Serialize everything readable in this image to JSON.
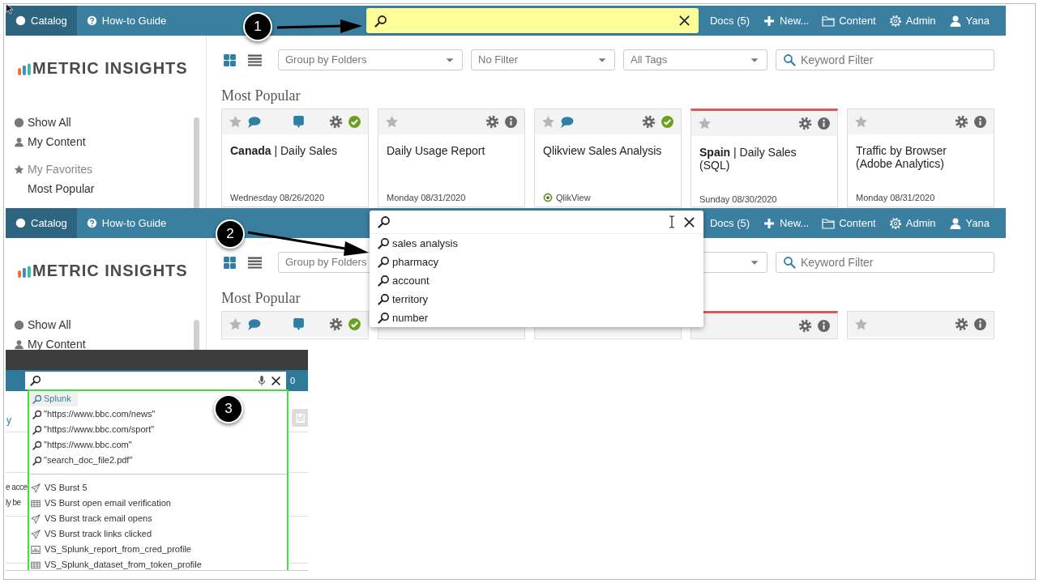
{
  "screenshot_1": {
    "nav": {
      "tabs": [
        {
          "label": "Catalog",
          "selected": true
        },
        {
          "label": "How-to Guide",
          "selected": false
        }
      ],
      "search": {
        "highlighted": true
      },
      "menu": [
        {
          "kind": "docs",
          "label": "Docs (5)"
        },
        {
          "kind": "new",
          "label": "New..."
        },
        {
          "kind": "content",
          "label": "Content"
        },
        {
          "kind": "admin",
          "label": "Admin"
        },
        {
          "kind": "user",
          "label": "Yana"
        }
      ]
    },
    "sidebar": {
      "logo": "METRIC INSIGHTS",
      "items": [
        {
          "kind": "all",
          "label": "Show All"
        },
        {
          "kind": "mine",
          "label": "My Content"
        },
        {
          "kind": "favorites",
          "label": "My Favorites"
        },
        {
          "kind": "sub",
          "label": "Most Popular"
        }
      ]
    },
    "toolbar": {
      "views": [
        {
          "kind": "grid",
          "selected": true
        },
        {
          "kind": "list",
          "selected": false
        }
      ],
      "selects": [
        {
          "label": "Group by Folders"
        },
        {
          "label": "No Filter"
        },
        {
          "label": "All Tags"
        }
      ],
      "keyword_filter": {
        "placeholder": "Keyword Filter"
      }
    },
    "section_title": "Most Popular",
    "cards": [
      {
        "header_left": [
          {
            "kind": "star"
          },
          {
            "kind": "comment"
          },
          {
            "kind": "discussion"
          }
        ],
        "header_right": [
          {
            "kind": "settings"
          },
          {
            "kind": "certified"
          }
        ],
        "alert": false,
        "title": "**Canada** | Daily Sales",
        "footer": {
          "kind": "date",
          "text": "Wednesday 08/26/2020"
        }
      },
      {
        "header_left": [
          {
            "kind": "star"
          }
        ],
        "header_right": [
          {
            "kind": "settings"
          },
          {
            "kind": "info"
          }
        ],
        "alert": false,
        "title": "Daily Usage Report",
        "footer": {
          "kind": "date",
          "text": "Monday 08/31/2020"
        }
      },
      {
        "header_left": [
          {
            "kind": "star"
          },
          {
            "kind": "comment"
          }
        ],
        "header_right": [
          {
            "kind": "settings"
          },
          {
            "kind": "certified"
          }
        ],
        "alert": false,
        "title": "Qlikview Sales Analysis",
        "footer": {
          "kind": "source",
          "text": "QlikView"
        }
      },
      {
        "header_left": [
          {
            "kind": "star"
          }
        ],
        "header_right": [
          {
            "kind": "settings"
          },
          {
            "kind": "info"
          }
        ],
        "alert": true,
        "title": "**Spain** | Daily Sales (SQL)",
        "footer": {
          "kind": "date",
          "text": "Sunday 08/30/2020"
        }
      },
      {
        "header_left": [
          {
            "kind": "star"
          }
        ],
        "header_right": [
          {
            "kind": "settings"
          },
          {
            "kind": "info"
          }
        ],
        "alert": false,
        "title": "Traffic by Browser (Adobe Analytics)",
        "footer": {
          "kind": "date",
          "text": "Monday 08/31/2020"
        }
      }
    ]
  },
  "screenshot_2": {
    "nav": {
      "tabs": [
        {
          "label": "Catalog",
          "selected": true
        },
        {
          "label": "How-to Guide",
          "selected": false
        }
      ],
      "search": {
        "highlighted": false,
        "suggestions": [
          "sales analysis",
          "pharmacy",
          "account",
          "territory",
          "number"
        ]
      },
      "menu": [
        {
          "kind": "docs",
          "label": "Docs (5)"
        },
        {
          "kind": "new",
          "label": "New..."
        },
        {
          "kind": "content",
          "label": "Content"
        },
        {
          "kind": "admin",
          "label": "Admin"
        },
        {
          "kind": "user",
          "label": "Yana"
        }
      ]
    },
    "sidebar": {
      "logo": "METRIC INSIGHTS",
      "items": [
        {
          "kind": "all",
          "label": "Show All"
        },
        {
          "kind": "mine",
          "label": "My Content"
        }
      ]
    },
    "toolbar": {
      "views": [
        {
          "kind": "grid",
          "selected": true
        },
        {
          "kind": "list",
          "selected": false
        }
      ],
      "selects": [
        {
          "label": "Group by Folders"
        }
      ],
      "keyword_filter": {
        "placeholder": "Keyword Filter"
      }
    },
    "section_title": "Most Popular",
    "cards": [
      {
        "header_left": [
          {
            "kind": "star"
          },
          {
            "kind": "comment"
          },
          {
            "kind": "discussion"
          }
        ],
        "header_right": [
          {
            "kind": "settings"
          },
          {
            "kind": "certified"
          }
        ],
        "alert": false
      },
      {
        "alert": false
      },
      {
        "alert": false
      },
      {
        "header_right": [
          {
            "kind": "settings"
          },
          {
            "kind": "info"
          }
        ],
        "alert": true
      },
      {
        "header_left": [
          {
            "kind": "star"
          }
        ],
        "header_right": [
          {
            "kind": "settings"
          },
          {
            "kind": "info"
          }
        ],
        "alert": false
      }
    ]
  },
  "screenshot_3": {
    "badge": "0",
    "link_fragment": "y",
    "text_fragments": [
      "e acce",
      "ly be"
    ],
    "suggestions": [
      {
        "text": "Splunk",
        "selected": true
      },
      {
        "text": "\"https://www.bbc.com/news\"",
        "selected": false
      },
      {
        "text": "\"https://www.bbc.com/sport\"",
        "selected": false
      },
      {
        "text": "\"https://www.bbc.com\"",
        "selected": false
      },
      {
        "text": "\"search_doc_file2.pdf\"",
        "selected": false
      }
    ],
    "results": [
      {
        "kind": "burst",
        "label": "VS Burst 5"
      },
      {
        "kind": "dataset",
        "label": "VS Burst open email verification"
      },
      {
        "kind": "burst",
        "label": "VS Burst track email opens"
      },
      {
        "kind": "burst",
        "label": "VS Burst track links clicked"
      },
      {
        "kind": "report",
        "label": "VS_Splunk_report_from_cred_profile"
      },
      {
        "kind": "dataset",
        "label": "VS_Splunk_dataset_from_token_profile"
      }
    ]
  },
  "callouts": [
    {
      "label": "1"
    },
    {
      "label": "2"
    },
    {
      "label": "3"
    }
  ]
}
